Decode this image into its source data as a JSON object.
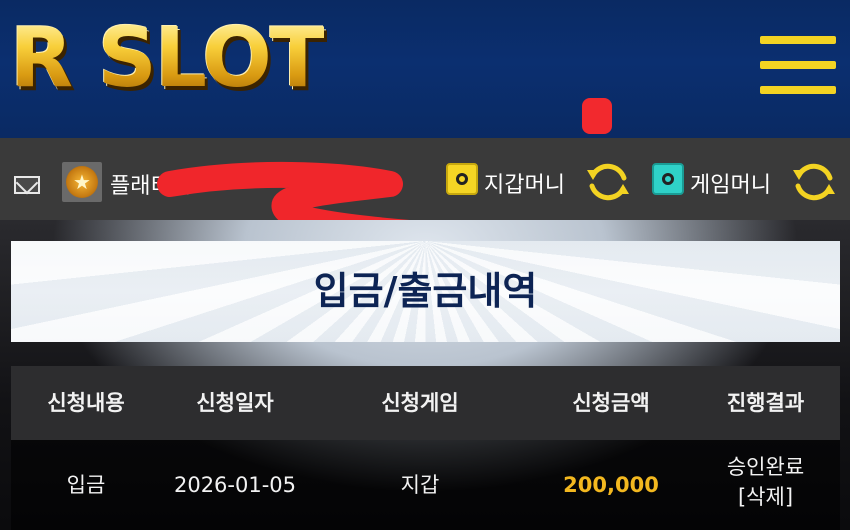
{
  "header": {
    "logo_text": "R SLOT",
    "menu_icon": "hamburger-icon",
    "accent_color": "#f3d322"
  },
  "userbar": {
    "mail_icon": "mail-icon",
    "rank_icon": "rank-badge-icon",
    "username_visible": "플래티넘",
    "wallet": {
      "icon": "safe-icon",
      "label": "지갑머니",
      "refresh_icon": "refresh-icon"
    },
    "game": {
      "icon": "safe-icon",
      "label": "게임머니",
      "refresh_icon": "refresh-icon"
    }
  },
  "page": {
    "title": "입금/출금내역"
  },
  "table": {
    "columns": [
      "신청내용",
      "신청일자",
      "신청게임",
      "신청금액",
      "진행결과"
    ],
    "rows": [
      {
        "type": "입금",
        "date": "2026-01-05",
        "game": "지갑",
        "amount": "200,000",
        "status": "승인완료",
        "action": "[삭제]"
      }
    ],
    "amount_color": "#f3b81f"
  }
}
